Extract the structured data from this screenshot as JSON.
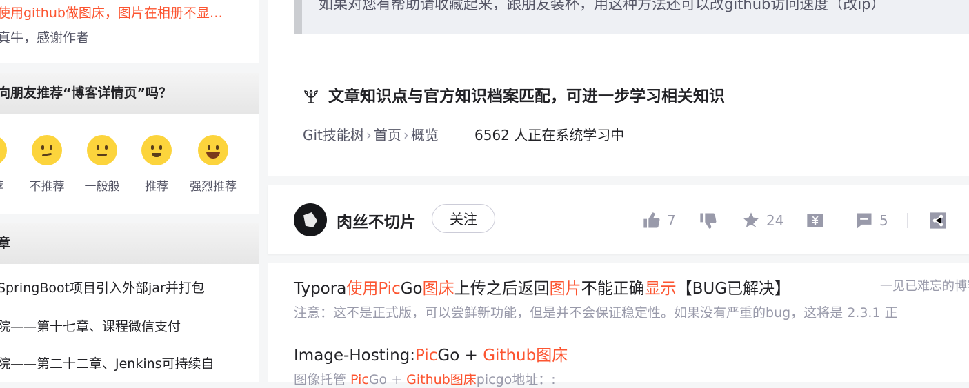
{
  "sidebar": {
    "comment": {
      "title": "使用github做图床，图片在相册不显…",
      "body": "真牛，感谢作者"
    },
    "rating": {
      "heading": "向朋友推荐“博客详情页”吗？",
      "options": [
        {
          "label": "推荐",
          "icon": "neutral-emoji-icon"
        },
        {
          "label": "不推荐",
          "icon": "sad-emoji-icon"
        },
        {
          "label": "一般般",
          "icon": "neutral-emoji-icon"
        },
        {
          "label": "推荐",
          "icon": "smile-emoji-icon"
        },
        {
          "label": "强烈推荐",
          "icon": "laugh-emoji-icon"
        }
      ]
    },
    "articles": {
      "heading": "章",
      "items": [
        "SpringBoot项目引入外部jar并打包",
        "院——第十七章、课程微信支付",
        "院——第二十二章、Jenkins可持续自"
      ]
    }
  },
  "main": {
    "quote": "如果对您有帮助请收藏起来，跟朋友装杯，用这种方法还可以改github访问速度（改ip）",
    "knowledge": {
      "title": "文章知识点与官方知识档案匹配，可进一步学习相关知识",
      "path": [
        "Git技能树",
        "首页",
        "概览"
      ],
      "count": "6562 人正在系统学习中"
    },
    "author_bar": {
      "author": "肉丝不切片",
      "follow_label": "关注",
      "likes": "7",
      "favorites": "24",
      "comments": "5"
    },
    "recommendations": [
      {
        "title_parts": [
          {
            "t": "Typora",
            "hl": false
          },
          {
            "t": "使用",
            "hl": true
          },
          {
            "t": "Pic",
            "hl": true
          },
          {
            "t": "Go",
            "hl": false
          },
          {
            "t": "图床",
            "hl": true
          },
          {
            "t": "上传之后返回",
            "hl": false
          },
          {
            "t": "图片",
            "hl": true
          },
          {
            "t": "不能正确",
            "hl": false
          },
          {
            "t": "显示",
            "hl": true
          },
          {
            "t": "【BUG已解决】",
            "hl": false
          }
        ],
        "author": "一见已难忘的博客",
        "desc": "注意：这不是正式版，可以尝鲜新功能，但是并不会保证稳定性。如果没有严重的bug，这将是 2.3.1 正"
      },
      {
        "title_parts": [
          {
            "t": "Image-Hosting:",
            "hl": false
          },
          {
            "t": "Pic",
            "hl": true
          },
          {
            "t": "Go + ",
            "hl": false
          },
          {
            "t": "Github图床",
            "hl": true
          }
        ],
        "desc_parts": [
          {
            "t": "图像托管 ",
            "hl": false
          },
          {
            "t": "Pic",
            "hl": true
          },
          {
            "t": "Go + ",
            "hl": false
          },
          {
            "t": "Github图床",
            "hl": true
          },
          {
            "t": "picgo地址：:",
            "hl": false
          }
        ]
      }
    ]
  },
  "colors": {
    "accent": "#fc5531",
    "text": "#222226",
    "muted": "#999aaa",
    "bg": "#f5f6f7"
  }
}
